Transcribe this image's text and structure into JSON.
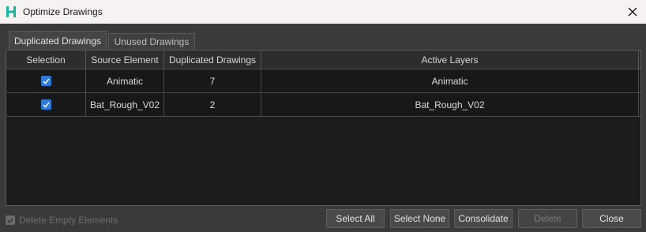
{
  "window": {
    "title": "Optimize Drawings",
    "logo_letter": "H",
    "logo_color": "#19b3a6",
    "close_icon": "close-icon"
  },
  "tabs": [
    {
      "label": "Duplicated Drawings",
      "active": true
    },
    {
      "label": "Unused Drawings",
      "active": false
    }
  ],
  "table": {
    "headers": [
      "Selection",
      "Source Element",
      "Duplicated Drawings",
      "Active Layers"
    ],
    "rows": [
      {
        "selected": true,
        "source": "Animatic",
        "duplicates": "7",
        "layers": "Animatic"
      },
      {
        "selected": true,
        "source": "Bat_Rough_V02",
        "duplicates": "2",
        "layers": "Bat_Rough_V02"
      }
    ]
  },
  "footer": {
    "delete_empty_label": "Delete Empty Elements",
    "delete_empty_checked": true,
    "delete_empty_enabled": false
  },
  "buttons": {
    "select_all": "Select All",
    "select_none": "Select None",
    "consolidate": "Consolidate",
    "delete": "Delete",
    "close": "Close"
  },
  "colors": {
    "checkbox_accent": "#2f7ad8",
    "panel_bg": "#1c1c1c",
    "window_bg": "#3a3a3a"
  }
}
